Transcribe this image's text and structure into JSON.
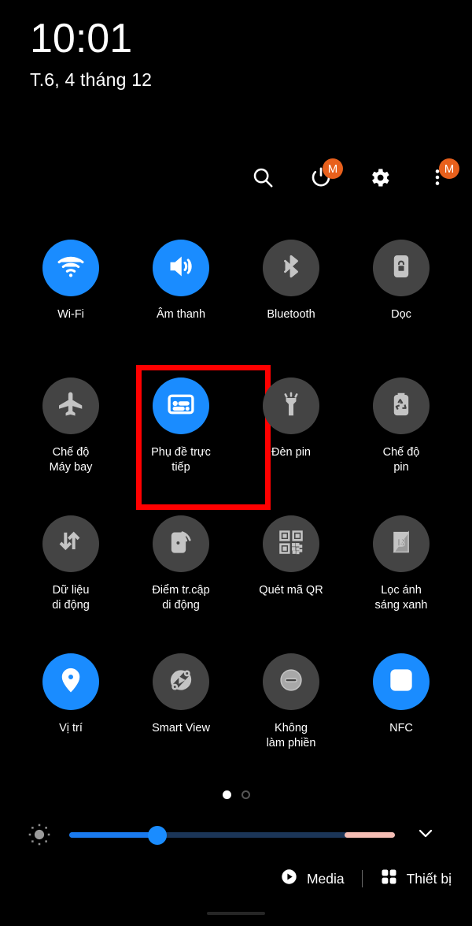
{
  "statusbar": {
    "time": "10:01",
    "date": "T.6, 4 tháng 12"
  },
  "header": {
    "icons": [
      {
        "name": "search-icon",
        "label": "Tìm kiếm",
        "badge": null
      },
      {
        "name": "power-icon",
        "label": "Nguồn",
        "badge": "M"
      },
      {
        "name": "gear-icon",
        "label": "Cài đặt",
        "badge": null
      },
      {
        "name": "overflow-menu-icon",
        "label": "Thêm",
        "badge": "M"
      }
    ],
    "badge_color": "#e8601c"
  },
  "colors": {
    "active_tile": "#1a8cff",
    "inactive_tile": "#444444",
    "highlight_box": "#ff0000",
    "background": "#000000"
  },
  "tiles": [
    {
      "label": "Wi-Fi",
      "icon": "wifi-icon",
      "state": "on"
    },
    {
      "label": "Âm thanh",
      "icon": "sound-icon",
      "state": "on"
    },
    {
      "label": "Bluetooth",
      "icon": "bluetooth-icon",
      "state": "off"
    },
    {
      "label": "Dọc",
      "icon": "rotation-lock-icon",
      "state": "off"
    },
    {
      "label": "Chế độ\nMáy bay",
      "icon": "airplane-icon",
      "state": "off"
    },
    {
      "label": "Phụ đề trực\ntiếp",
      "icon": "live-caption-icon",
      "state": "on"
    },
    {
      "label": "Đèn pin",
      "icon": "flashlight-icon",
      "state": "off"
    },
    {
      "label": "Chế độ\npin",
      "icon": "battery-saver-icon",
      "state": "off"
    },
    {
      "label": "Dữ liệu\ndi động",
      "icon": "mobile-data-icon",
      "state": "off"
    },
    {
      "label": "Điểm tr.cập\ndi động",
      "icon": "hotspot-icon",
      "state": "off"
    },
    {
      "label": "Quét mã QR",
      "icon": "qr-code-icon",
      "state": "off"
    },
    {
      "label": "Lọc ánh\nsáng xanh",
      "icon": "blue-light-filter-icon",
      "state": "off"
    },
    {
      "label": "Vị trí",
      "icon": "location-pin-icon",
      "state": "on"
    },
    {
      "label": "Smart View",
      "icon": "smart-view-icon",
      "state": "off"
    },
    {
      "label": "Không\nlàm phiền",
      "icon": "do-not-disturb-icon",
      "state": "off"
    },
    {
      "label": "NFC",
      "icon": "nfc-icon",
      "state": "on"
    }
  ],
  "highlighted_tile_index": 5,
  "pager": {
    "total": 2,
    "current": 1
  },
  "brightness": {
    "icon": "brightness-icon",
    "value_percent": 27,
    "fill_color": "#1a7aee",
    "track_color": "#1b3557",
    "warm_segment_color": "#f5bdb4",
    "expand_icon": "chevron-down-icon"
  },
  "bottom_bar": {
    "media_label": "Media",
    "media_icon": "play-circle-icon",
    "devices_label": "Thiết bị",
    "devices_icon": "grid-squares-icon"
  }
}
